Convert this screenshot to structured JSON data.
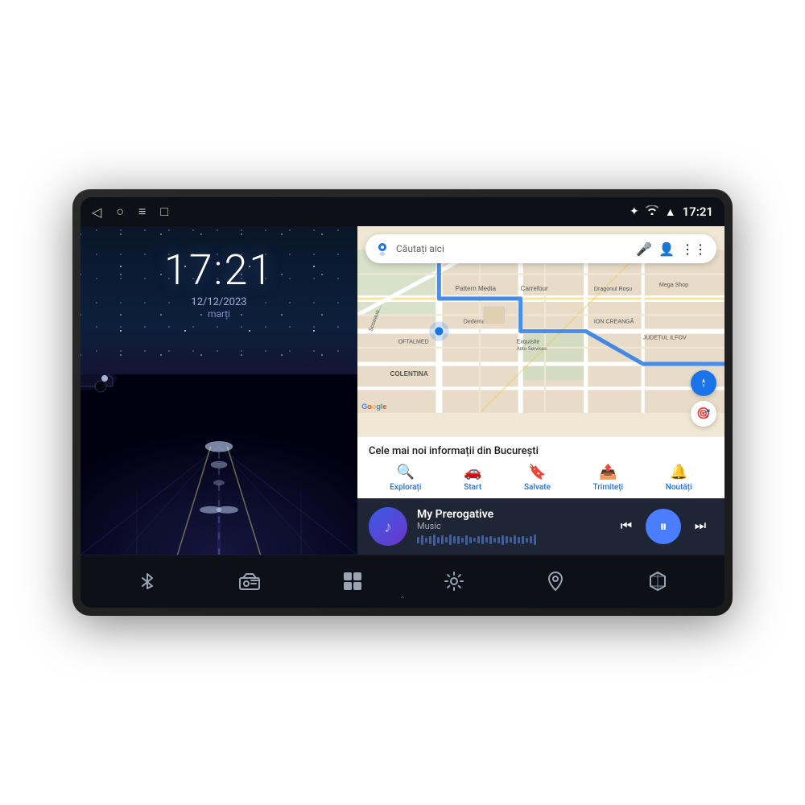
{
  "device": {
    "statusBar": {
      "navBack": "◁",
      "navHome": "○",
      "navMenu": "≡",
      "navRecent": "□",
      "iconBluetooth": "✦",
      "iconWifi": "WiFi",
      "iconSignal": "▲",
      "time": "17:21"
    },
    "leftPanel": {
      "time": "17:21",
      "date": "12/12/2023",
      "day": "marți"
    },
    "rightPanel": {
      "maps": {
        "searchPlaceholder": "Căutați aici",
        "infoTitle": "Cele mai noi informații din București",
        "navItems": [
          {
            "icon": "🔍",
            "label": "Explorați"
          },
          {
            "icon": "🚗",
            "label": "Start"
          },
          {
            "icon": "🔖",
            "label": "Salvate"
          },
          {
            "icon": "📤",
            "label": "Trimiteți"
          },
          {
            "icon": "🔔",
            "label": "Noutăți"
          }
        ]
      },
      "music": {
        "title": "My Prerogative",
        "subtitle": "Music",
        "albumArt": "♪",
        "controls": {
          "prev": "⏮",
          "play": "⏸",
          "next": "⏭"
        }
      }
    },
    "dock": {
      "items": [
        {
          "icon": "bluetooth",
          "label": ""
        },
        {
          "icon": "radio",
          "label": ""
        },
        {
          "icon": "apps",
          "label": ""
        },
        {
          "icon": "settings",
          "label": ""
        },
        {
          "icon": "maps",
          "label": ""
        },
        {
          "icon": "cube",
          "label": ""
        }
      ]
    }
  }
}
